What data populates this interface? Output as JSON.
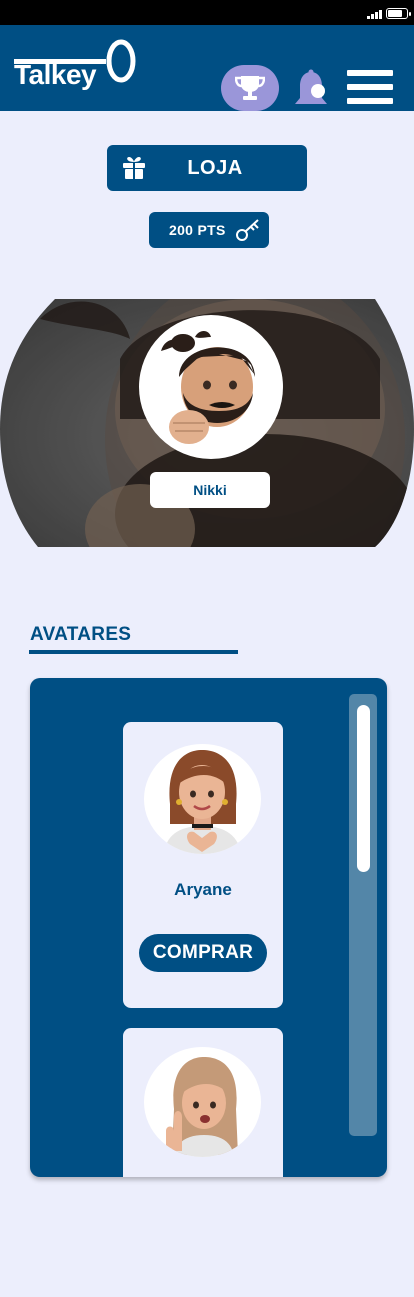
{
  "header": {
    "logo_text": "Talkey",
    "icons": {
      "trophy": "trophy-icon",
      "bell": "bell-icon",
      "menu": "menu-icon"
    }
  },
  "store": {
    "label": "LOJA",
    "icon": "gift-icon"
  },
  "points": {
    "label": "200 PTS",
    "icon": "key-icon"
  },
  "profile": {
    "name": "Nikki"
  },
  "avatars_section": {
    "title": "AVATARES",
    "cards": [
      {
        "name": "Aryane",
        "buy_label": "COMPRAR"
      },
      {
        "name": "",
        "buy_label": ""
      }
    ],
    "scroll_position": 0
  },
  "colors": {
    "primary": "#004f84",
    "background": "#eceefc",
    "accent": "#9a96d9",
    "scrollbar": "#5386a8"
  }
}
